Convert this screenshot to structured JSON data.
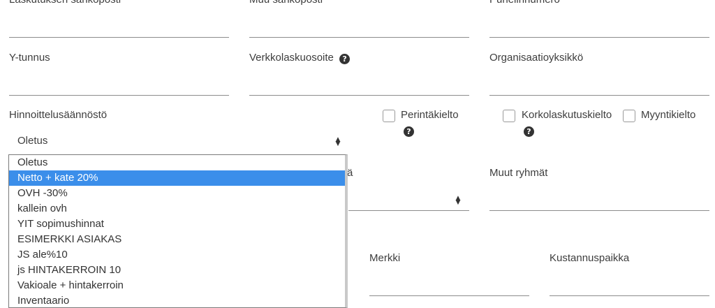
{
  "fields": {
    "billing_email": "Laskutuksen sähköposti",
    "other_email": "Muu sähköposti",
    "phone": "Puhelinnumero",
    "business_id": "Y-tunnus",
    "einvoice_address": "Verkkolaskuosoite",
    "org_unit": "Organisaatioyksikkö",
    "pricing_rule": "Hinnoittelusäännöstö",
    "pricing_rule_value": "Oletus",
    "collection_ban": "Perintäkielto",
    "interest_ban": "Korkolaskutuskielto",
    "sales_ban": "Myyntikielto",
    "hidden_label_tail": "ä",
    "other_groups": "Muut ryhmät",
    "mark": "Merkki",
    "cost_center": "Kustannuspaikka"
  },
  "icons": {
    "help": "?",
    "select_caret": "▲▼"
  },
  "dropdown": {
    "selected_index": 1,
    "options": [
      "Oletus",
      "Netto + kate 20%",
      "OVH -30%",
      "kallein ovh",
      "YIT sopimushinnat",
      "ESIMERKKI ASIAKAS",
      "JS ale%10",
      "js HINTAKERROIN 10",
      "Vakioale + hintakerroin",
      "Inventaario"
    ]
  },
  "colors": {
    "highlight": "#3b8eea",
    "text": "#3d3d3d",
    "underline": "#8c8c8c"
  }
}
